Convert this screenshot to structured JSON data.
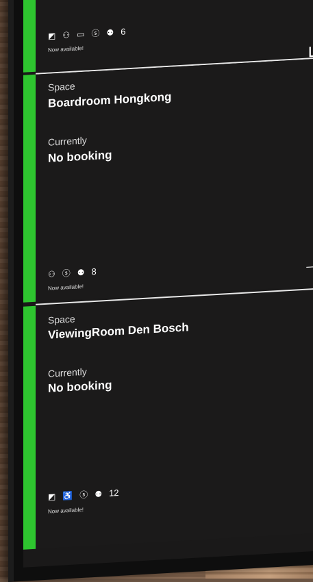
{
  "cards": [
    {
      "amenities": [
        "tv-icon",
        "people-icon",
        "monitor-icon",
        "skype-icon",
        "capacity-icon"
      ],
      "capacity": "6",
      "status": "Now available!",
      "arrow": "↳"
    },
    {
      "space_label": "Space",
      "space_name": "Boardroom Hongkong",
      "currently_label": "Currently",
      "booking": "No booking",
      "amenities": [
        "people-icon",
        "skype-icon",
        "capacity-icon"
      ],
      "capacity": "8",
      "status": "Now available!",
      "arrow": "→"
    },
    {
      "space_label": "Space",
      "space_name": "ViewingRoom Den Bosch",
      "currently_label": "Currently",
      "booking": "No booking",
      "amenities": [
        "tv-icon",
        "accessible-icon",
        "skype-icon",
        "capacity-icon"
      ],
      "capacity": "12",
      "status": "Now available!",
      "arrow": "↓"
    }
  ],
  "colors": {
    "available": "#2ec52f",
    "panel": "#1b1a1a",
    "text": "#ffffff"
  }
}
